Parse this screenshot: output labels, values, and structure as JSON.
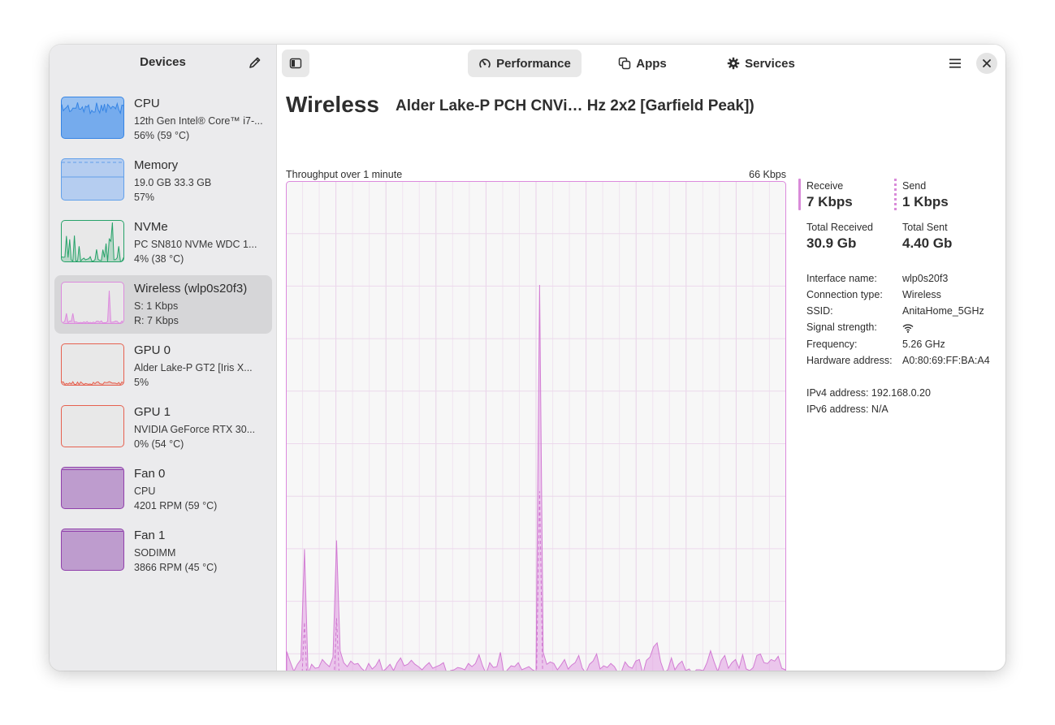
{
  "sidebar": {
    "title": "Devices",
    "devices": [
      {
        "name": "CPU",
        "line1": "12th Gen Intel® Core™ i7-...",
        "line2": "56% (59 °C)",
        "color": "#3584e4"
      },
      {
        "name": "Memory",
        "line1": "19.0 GB 33.3 GB",
        "line2": "57%",
        "color": "#62a0ea"
      },
      {
        "name": "NVMe",
        "line1": "PC SN810 NVMe WDC 1...",
        "line2": "4% (38 °C)",
        "color": "#26a269"
      },
      {
        "name": "Wireless (wlp0s20f3)",
        "line1": "S: 1 Kbps",
        "line2": "R: 7 Kbps",
        "color": "#dc8add"
      },
      {
        "name": "GPU 0",
        "line1": "Alder Lake-P GT2 [Iris X...",
        "line2": "5%",
        "color": "#e66150"
      },
      {
        "name": "GPU 1",
        "line1": "NVIDIA GeForce RTX 30...",
        "line2": "0% (54 °C)",
        "color": "#e66150"
      },
      {
        "name": "Fan 0",
        "line1": "CPU",
        "line2": "4201 RPM (59 °C)",
        "color": "#9141ac"
      },
      {
        "name": "Fan 1",
        "line1": "SODIMM",
        "line2": "3866 RPM (45 °C)",
        "color": "#9141ac"
      }
    ]
  },
  "header": {
    "tabs": [
      {
        "label": "Performance",
        "icon": "speedometer-icon",
        "active": true
      },
      {
        "label": "Apps",
        "icon": "apps-icon",
        "active": false
      },
      {
        "label": "Services",
        "icon": "gear-icon",
        "active": false
      }
    ]
  },
  "main": {
    "title": "Wireless",
    "subtitle": "Alder Lake-P PCH CNVi… Hz 2x2 [Garfield Peak])",
    "graph_caption": "Throughput over 1 minute",
    "graph_max": "66 Kbps",
    "accent": "#dc8add",
    "receive_label": "Receive",
    "receive_value": "7 Kbps",
    "send_label": "Send",
    "send_value": "1 Kbps",
    "total_received_label": "Total Received",
    "total_received_value": "30.9 Gb",
    "total_sent_label": "Total Sent",
    "total_sent_value": "4.40 Gb",
    "info": [
      {
        "key": "Interface name:",
        "value": "wlp0s20f3"
      },
      {
        "key": "Connection type:",
        "value": "Wireless"
      },
      {
        "key": "SSID:",
        "value": "AnitaHome_5GHz"
      },
      {
        "key": "Signal strength:",
        "value": ""
      },
      {
        "key": "Frequency:",
        "value": "5.26 GHz"
      },
      {
        "key": "Hardware address:",
        "value": "A0:80:69:FF:BA:A4"
      }
    ],
    "ipv4_label": "IPv4 address:",
    "ipv4_value": "192.168.0.20",
    "ipv6_label": "IPv6 address:",
    "ipv6_value": "N/A"
  },
  "chart_data": {
    "type": "area",
    "ylim": [
      0,
      66
    ],
    "series": [
      {
        "values": [
          6.8,
          5.5,
          4.3,
          5.2,
          5.8,
          19.7,
          4.0,
          5.2,
          4.7,
          4.8,
          5.8,
          5.3,
          4.9,
          6.1,
          20.8,
          6.9,
          5.4,
          4.9,
          5.6,
          5.2,
          5.3,
          4.7,
          4.3,
          5.3,
          4.6,
          5.0,
          5.8,
          4.3,
          4.7,
          5.2,
          4.4,
          5.4,
          6.0,
          5.0,
          5.2,
          5.7,
          5.2,
          4.9,
          4.5,
          5.0,
          5.4,
          4.7,
          4.9,
          5.1,
          5.4,
          4.0,
          4.4,
          4.5,
          4.8,
          4.7,
          4.5,
          5.3,
          4.9,
          5.3,
          6.4,
          5.0,
          4.0,
          5.4,
          4.8,
          4.9,
          6.7,
          4.0,
          4.5,
          5.0,
          4.9,
          5.4,
          4.5,
          4.7,
          4.9,
          4.5,
          4.3,
          53.0,
          6.7,
          5.2,
          5.5,
          5.3,
          4.5,
          5.1,
          5.8,
          4.6,
          5.1,
          5.4,
          6.3,
          4.7,
          4.1,
          5.2,
          5.6,
          6.5,
          4.6,
          5.0,
          4.8,
          5.3,
          4.9,
          4.1,
          4.3,
          5.5,
          4.9,
          4.7,
          5.6,
          5.8,
          4.0,
          5.7,
          6.1,
          7.4,
          7.9,
          5.5,
          4.2,
          4.5,
          6.0,
          4.5,
          5.2,
          5.6,
          4.4,
          4.6,
          4.0,
          4.5,
          4.5,
          4.4,
          5.4,
          6.9,
          5.5,
          4.3,
          5.7,
          6.3,
          4.7,
          5.4,
          5.8,
          4.7,
          6.4,
          4.6,
          4.4,
          4.8,
          6.3,
          6.5,
          5.4,
          5.3,
          5.8,
          5.6,
          6.2,
          4.7,
          4.5
        ]
      },
      {
        "values": [
          0.0,
          0.0,
          0.5,
          0.8,
          0.6,
          10.5,
          0.0,
          0.0,
          0.0,
          0.6,
          0.0,
          0.0,
          0.0,
          0.0,
          11.0,
          1.2,
          0.0,
          0.3,
          0.0,
          0.8,
          0.5,
          0.0,
          0.0,
          0.0,
          0.0,
          0.6,
          0.3,
          0.0,
          0.0,
          0.0,
          0.0,
          0.0,
          0.0,
          0.0,
          0.6,
          0.0,
          0.0,
          0.0,
          0.0,
          0.0,
          0.0,
          0.0,
          0.0,
          0.0,
          0.0,
          0.3,
          0.0,
          1.7,
          0.4,
          0.0,
          1.0,
          0.0,
          0.0,
          0.0,
          0.0,
          0.0,
          0.2,
          0.0,
          0.0,
          0.0,
          0.0,
          0.4,
          0.0,
          0.0,
          0.0,
          0.0,
          0.3,
          1.7,
          0.0,
          0.0,
          0.0,
          27.0,
          0.0,
          0.0,
          0.0,
          0.0,
          0.0,
          0.0,
          0.0,
          0.0,
          0.0,
          0.0,
          0.0,
          0.0,
          0.0,
          0.0,
          0.0,
          1.0,
          0.0,
          0.0,
          0.0,
          0.0,
          0.0,
          0.0,
          0.0,
          0.0,
          1.7,
          0.0,
          0.0,
          0.0,
          0.0,
          0.0,
          0.7,
          1.5,
          0.0,
          0.2,
          0.0,
          0.0,
          0.5,
          0.0,
          0.0,
          0.0,
          0.0,
          0.0,
          0.5,
          0.0,
          0.0,
          0.0,
          0.0,
          0.0,
          0.4,
          0.4,
          0.0,
          0.0,
          1.1,
          0.0,
          0.0,
          1.2,
          0.0,
          0.0,
          0.0,
          0.0,
          0.0,
          0.0,
          0.0,
          0.0,
          0.0,
          0.0,
          0.0
        ]
      }
    ]
  }
}
